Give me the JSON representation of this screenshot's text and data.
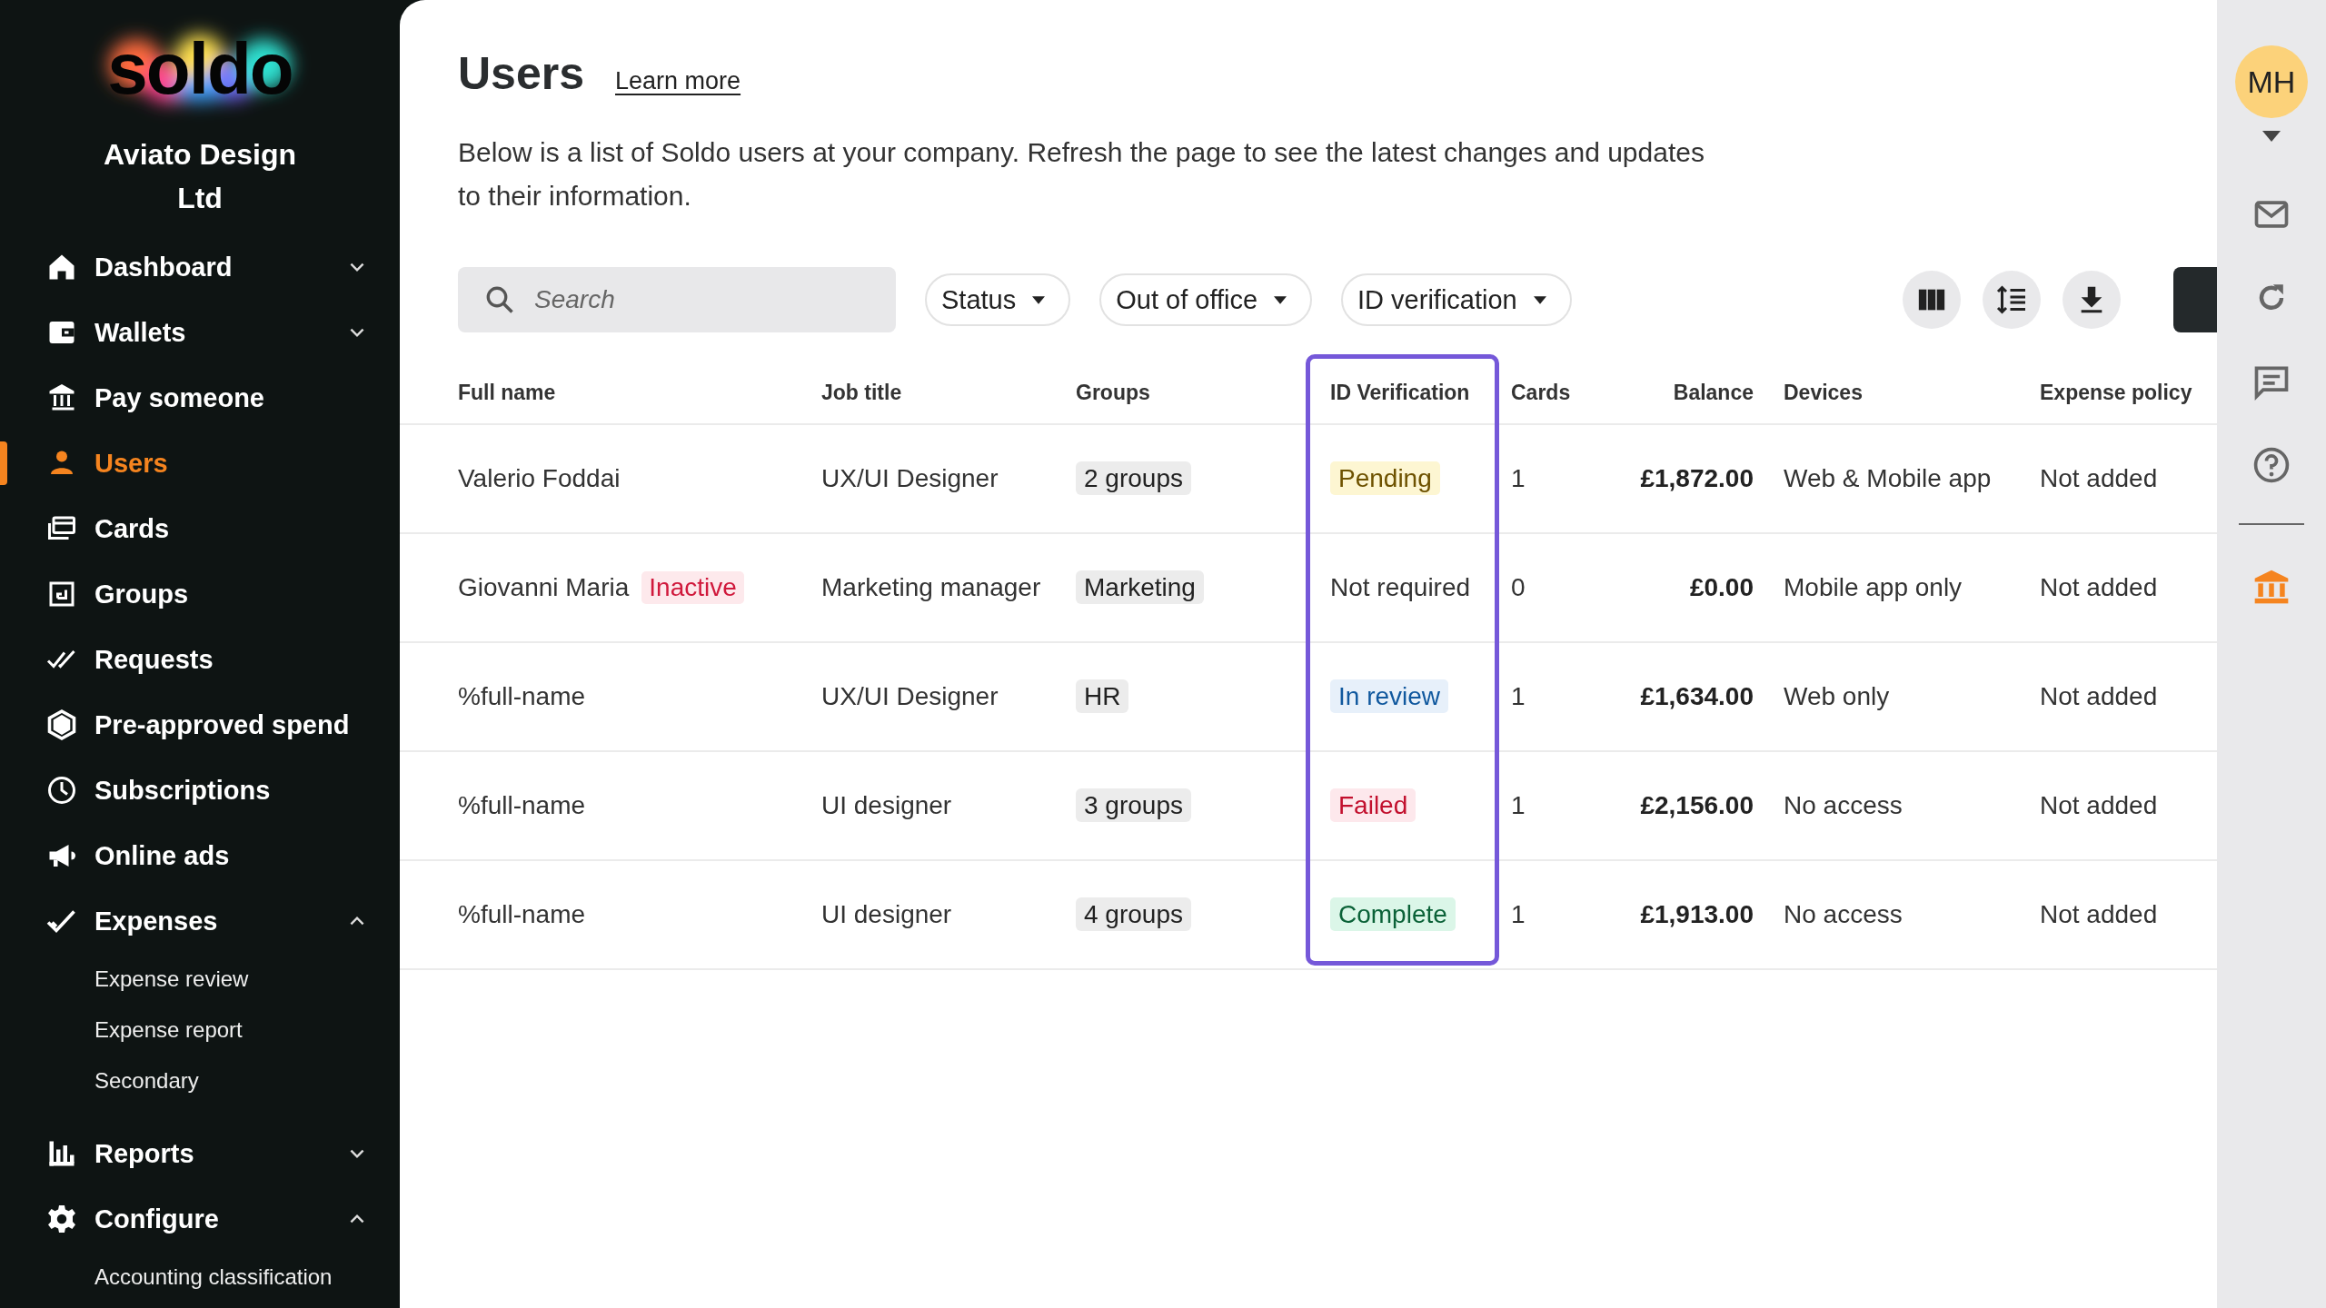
{
  "sidebar": {
    "logo": "soldo",
    "company": "Aviato Design Ltd",
    "items": [
      {
        "label": "Dashboard",
        "selected": false,
        "expanded": false
      },
      {
        "label": "Wallets",
        "selected": false,
        "expanded": false
      },
      {
        "label": "Pay someone",
        "selected": false
      },
      {
        "label": "Users",
        "selected": true
      },
      {
        "label": "Cards",
        "selected": false
      },
      {
        "label": "Groups",
        "selected": false
      },
      {
        "label": "Requests",
        "selected": false
      },
      {
        "label": "Pre-approved spend",
        "selected": false
      },
      {
        "label": "Subscriptions",
        "selected": false
      },
      {
        "label": "Online ads",
        "selected": false
      },
      {
        "label": "Expenses",
        "selected": false,
        "expanded": true,
        "children": [
          {
            "label": "Expense review"
          },
          {
            "label": "Expense report"
          },
          {
            "label": "Secondary"
          }
        ]
      },
      {
        "label": "Reports",
        "selected": false,
        "expanded": false
      },
      {
        "label": "Configure",
        "selected": false,
        "expanded": true,
        "children": [
          {
            "label": "Accounting classification"
          }
        ]
      }
    ]
  },
  "page": {
    "title": "Users",
    "link": "Learn more",
    "description": "Below is a list of Soldo users at your company. Refresh the page to see the latest changes and updates to their information."
  },
  "toolbar": {
    "search": {
      "placeholder": "Search"
    },
    "filters": [
      "Status",
      "Out of office",
      "ID verification"
    ]
  },
  "table": {
    "columns": [
      "Full name",
      "Job title",
      "Groups",
      "ID Verification",
      "Cards",
      "Balance",
      "Devices",
      "Expense policy"
    ],
    "rows": [
      {
        "name": "Valerio Foddai",
        "job": "UX/UI Designer",
        "group": "2 groups",
        "id": {
          "text": "Pending",
          "kind": "pending"
        },
        "cards": "1",
        "balance": "£1,872.00",
        "devices": "Web & Mobile app",
        "policy": "Not added"
      },
      {
        "name": "Giovanni Maria",
        "tag": "Inactive",
        "job": "Marketing manager",
        "group": "Marketing",
        "id": {
          "text": "Not required",
          "kind": "plain"
        },
        "cards": "0",
        "balance": "£0.00",
        "devices": "Mobile app only",
        "policy": "Not added"
      },
      {
        "name": "%full-name",
        "job": "UX/UI Designer",
        "group": "HR",
        "id": {
          "text": "In review",
          "kind": "review"
        },
        "cards": "1",
        "balance": "£1,634.00",
        "devices": "Web only",
        "policy": "Not added"
      },
      {
        "name": "%full-name",
        "job": "UI designer",
        "group": "3 groups",
        "id": {
          "text": "Failed",
          "kind": "failed"
        },
        "cards": "1",
        "balance": "£2,156.00",
        "devices": "No access",
        "policy": "Not added"
      },
      {
        "name": "%full-name",
        "job": "UI designer",
        "group": "4 groups",
        "id": {
          "text": "Complete",
          "kind": "complete"
        },
        "cards": "1",
        "balance": "£1,913.00",
        "devices": "No access",
        "policy": "Not added"
      }
    ]
  },
  "rail": {
    "avatar": "MH"
  }
}
